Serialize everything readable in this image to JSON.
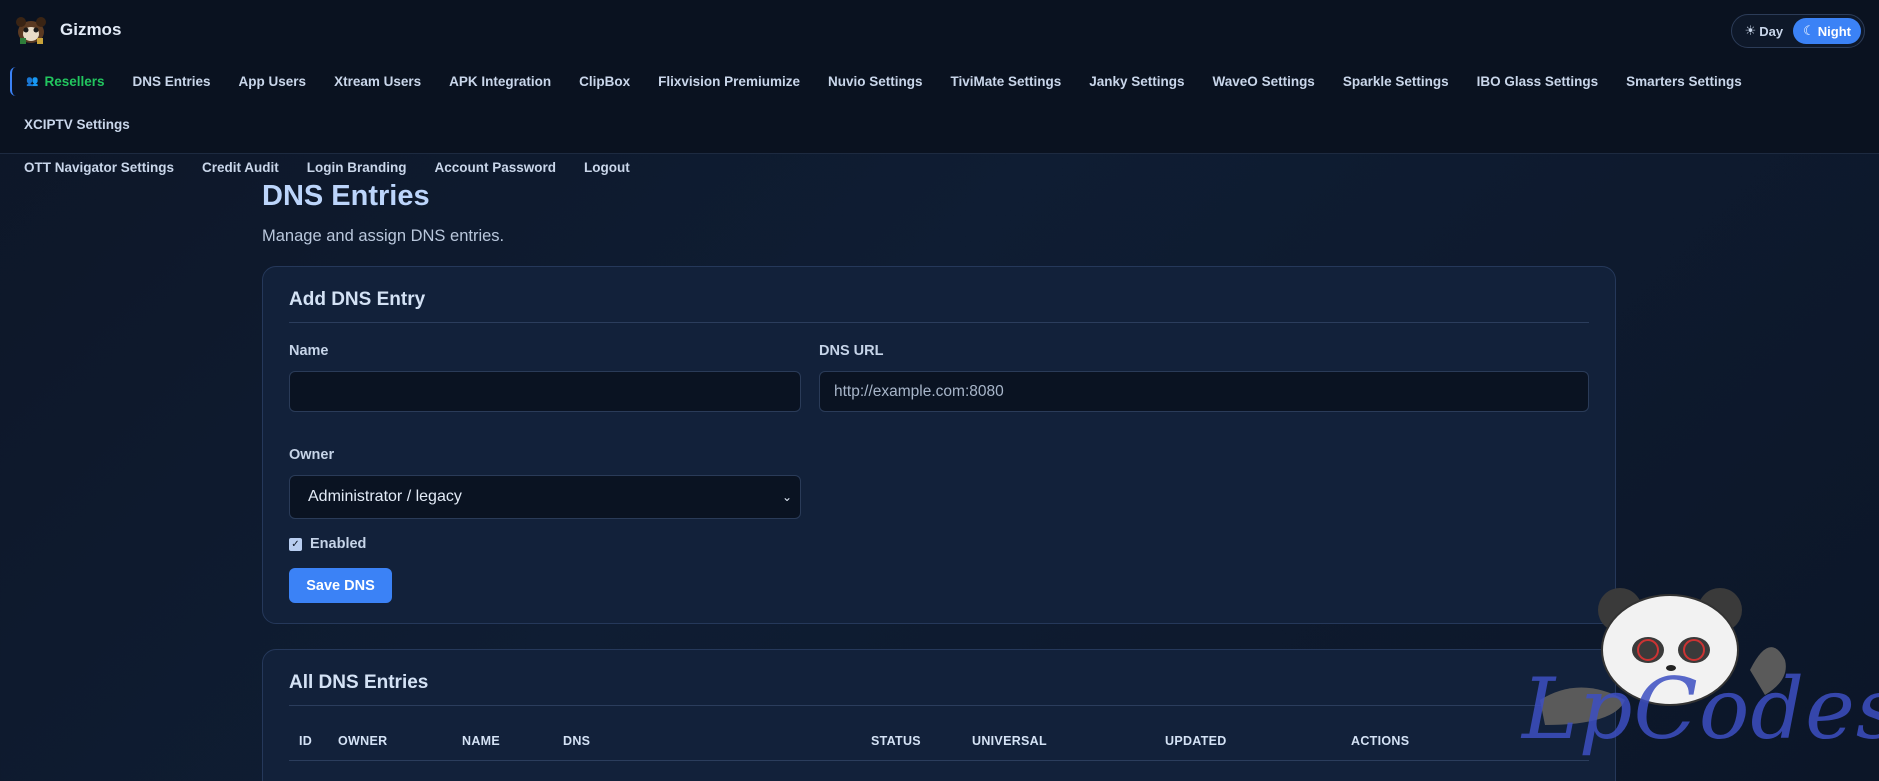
{
  "brand": {
    "name": "Gizmos"
  },
  "theme": {
    "day_label": "Day",
    "night_label": "Night",
    "day_icon": "sun-icon",
    "night_icon": "moon-icon"
  },
  "nav": {
    "items": [
      "Resellers",
      "DNS Entries",
      "App Users",
      "Xtream Users",
      "APK Integration",
      "ClipBox",
      "Flixvision Premiumize",
      "Nuvio Settings",
      "TiviMate Settings",
      "Janky Settings",
      "WaveO Settings",
      "Sparkle Settings",
      "IBO Glass Settings",
      "Smarters Settings",
      "XCIPTV Settings"
    ],
    "items_row2": [
      "OTT Navigator Settings",
      "Credit Audit",
      "Login Branding",
      "Account Password",
      "Logout"
    ],
    "active": "Resellers"
  },
  "page": {
    "title": "DNS Entries",
    "subtitle": "Manage and assign DNS entries."
  },
  "add_form": {
    "title": "Add DNS Entry",
    "name_label": "Name",
    "name_value": "",
    "dns_label": "DNS URL",
    "dns_placeholder": "http://example.com:8080",
    "owner_label": "Owner",
    "owner_selected": "Administrator / legacy",
    "enabled_label": "Enabled",
    "enabled_checked": true,
    "save_label": "Save DNS"
  },
  "list": {
    "title": "All DNS Entries",
    "columns": [
      "ID",
      "OWNER",
      "NAME",
      "DNS",
      "STATUS",
      "UNIVERSAL",
      "UPDATED",
      "ACTIONS"
    ]
  },
  "watermark": {
    "text": "LpCodes"
  },
  "colors": {
    "accent": "#3b82f6",
    "active_nav": "#22c55e",
    "title": "#bcd5fb"
  }
}
